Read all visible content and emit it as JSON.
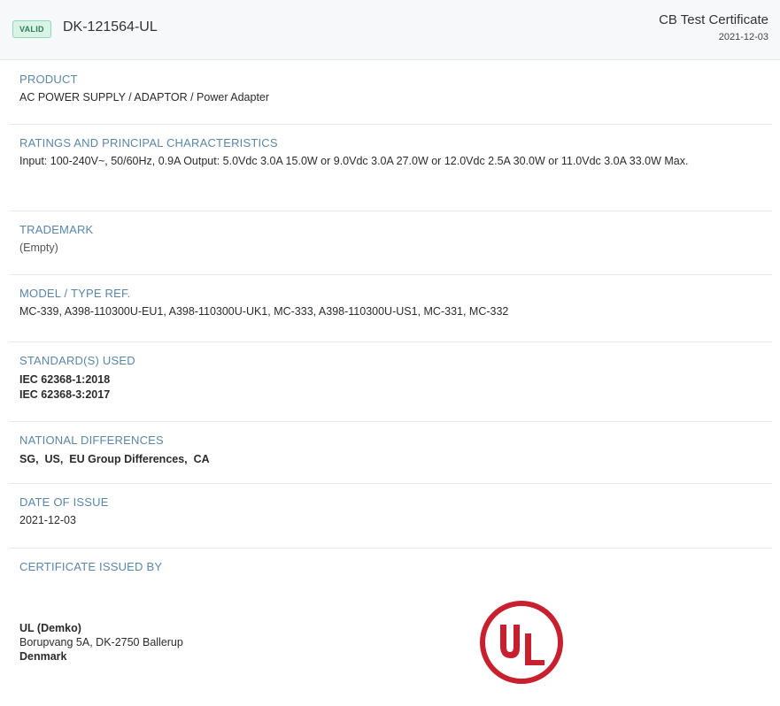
{
  "header": {
    "status_badge": "VALID",
    "certificate_id": "DK-121564-UL",
    "certificate_type": "CB Test Certificate",
    "date": "2021-12-03"
  },
  "sections": {
    "product": {
      "label": "PRODUCT",
      "value": "AC POWER SUPPLY / ADAPTOR / Power Adapter"
    },
    "ratings": {
      "label": "RATINGS AND PRINCIPAL CHARACTERISTICS",
      "value": "Input: 100-240V~, 50/60Hz, 0.9A Output: 5.0Vdc 3.0A 15.0W or 9.0Vdc 3.0A 27.0W or 12.0Vdc 2.5A 30.0W or 11.0Vdc 3.0A 33.0W Max."
    },
    "trademark": {
      "label": "TRADEMARK",
      "value": "(Empty)"
    },
    "model": {
      "label": "MODEL / TYPE REF.",
      "value": "MC-339, A398-110300U-EU1, A398-110300U-UK1, MC-333, A398-110300U-US1, MC-331, MC-332"
    },
    "standards": {
      "label": "STANDARD(S) USED",
      "items": [
        "IEC 62368-1:2018",
        "IEC 62368-3:2017"
      ]
    },
    "national_differences": {
      "label": "NATIONAL DIFFERENCES",
      "items": [
        "SG",
        "US",
        "EU Group Differences",
        "CA"
      ],
      "separator": ",  "
    },
    "date_of_issue": {
      "label": "DATE OF ISSUE",
      "value": "2021-12-03"
    },
    "issued_by": {
      "label": "CERTIFICATE ISSUED BY",
      "name": "UL (Demko)",
      "address": "Borupvang 5A, DK-2750 Ballerup",
      "country": "Denmark",
      "logo_text": "UL",
      "logo_color": "#c8202f"
    }
  }
}
